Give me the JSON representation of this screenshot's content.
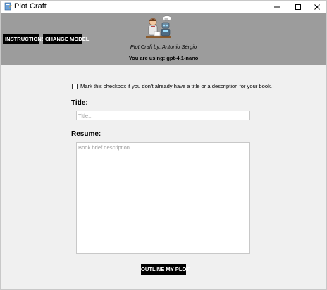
{
  "window": {
    "title": "Plot Craft",
    "controls": {
      "minimize_icon": "minimize-icon",
      "maximize_icon": "maximize-icon",
      "close_icon": "close-icon"
    }
  },
  "header": {
    "background": "#9c9c9c",
    "buttons": {
      "instructions_label": "INSTRUCTIONS",
      "change_model_label": "CHANGE MODEL"
    },
    "author": "Plot Craft by: Antonio Sérgio",
    "model_status": "You are using: gpt-4.1-nano"
  },
  "form": {
    "no_title_checkbox": {
      "checked": false,
      "label": "Mark this checkbox if you don't already have a title or a description for your book."
    },
    "title": {
      "label": "Title:",
      "value": "",
      "placeholder": "Title..."
    },
    "resume": {
      "label": "Resume:",
      "value": "",
      "placeholder": "Book brief description..."
    },
    "submit_label": "OUTLINE MY PLOT"
  },
  "colors": {
    "button_bg": "#000000",
    "button_text": "#ffffff",
    "body_bg": "#f0f0f0"
  }
}
